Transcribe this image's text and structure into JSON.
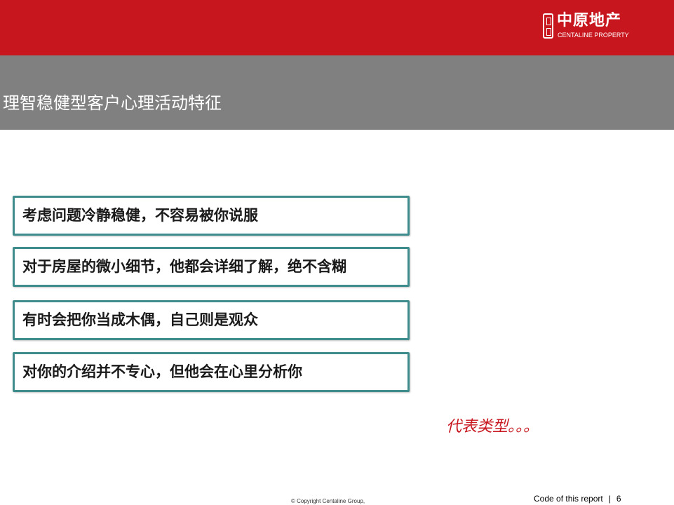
{
  "header": {
    "logo_cn": "中原地产",
    "logo_en": "CENTALINE PROPERTY",
    "colors": {
      "brand_red": "#c8161e",
      "title_gray": "#808080",
      "box_border": "#3f8c8c"
    }
  },
  "slide": {
    "title": "理智稳健型客户心理活动特征",
    "points": [
      "考虑问题冷静稳健，不容易被你说服",
      "对于房屋的微小细节，他都会详细了解，绝不含糊",
      "有时会把你当成木偶，自己则是观众",
      "对你的介绍并不专心，但他会在心里分析你"
    ],
    "representative": "代表类型。。。"
  },
  "footer": {
    "copyright": "© Copyright  Centaline Group,",
    "report_code": "Code of this report",
    "separator": "|",
    "page_number": "6"
  }
}
